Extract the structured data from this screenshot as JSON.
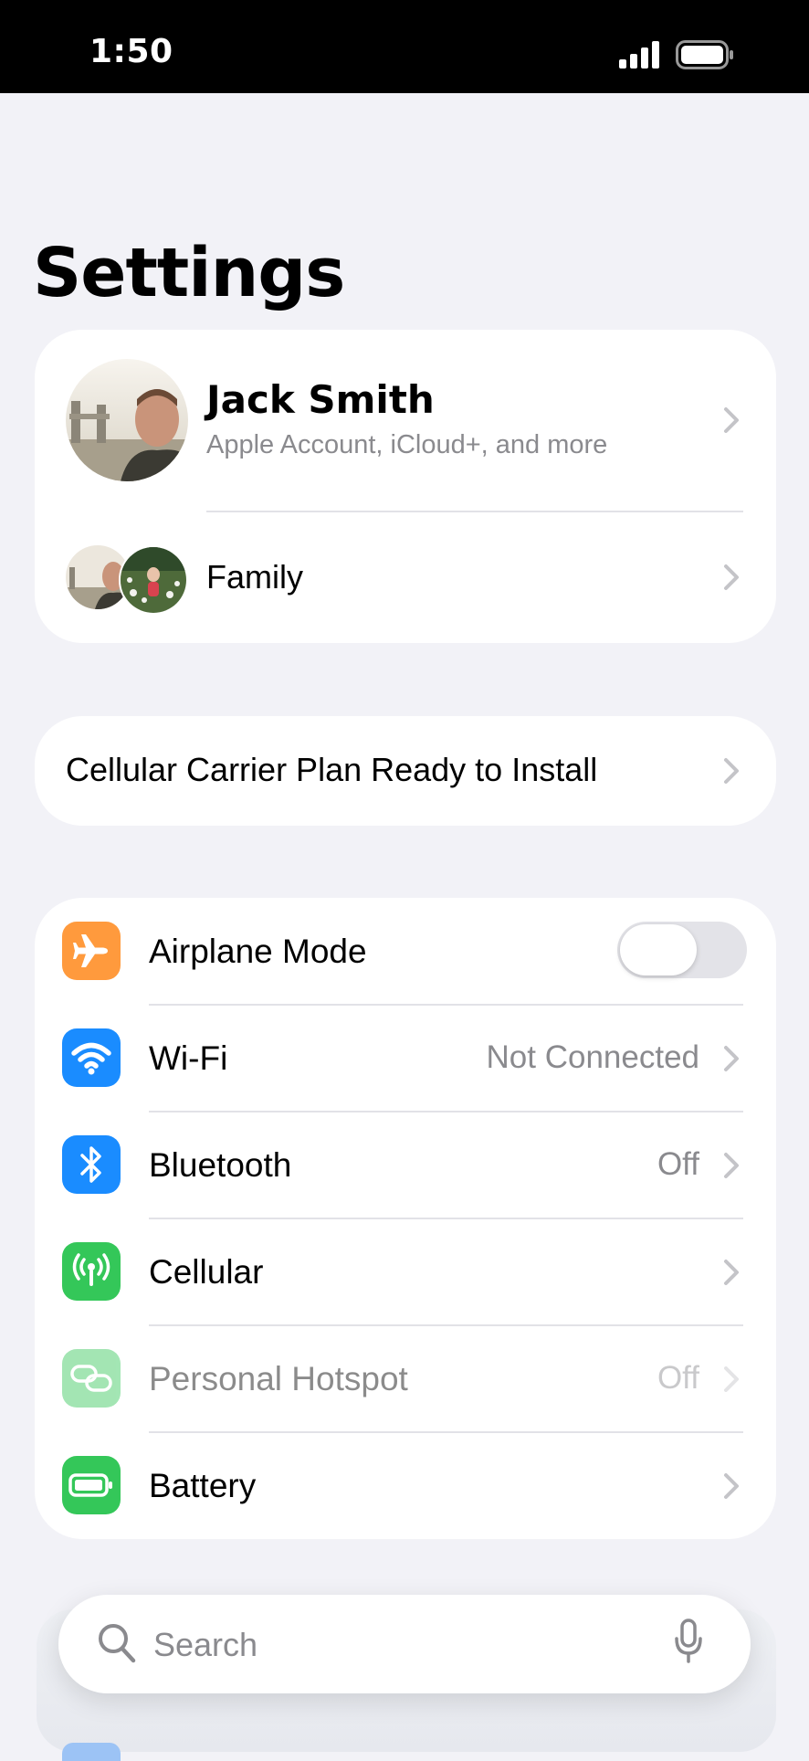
{
  "status_bar": {
    "time": "1:50"
  },
  "page": {
    "title": "Settings"
  },
  "account": {
    "name": "Jack Smith",
    "subtitle": "Apple Account, iCloud+, and more",
    "family_label": "Family"
  },
  "carrier_banner": {
    "label": "Cellular Carrier Plan Ready to Install"
  },
  "settings": [
    {
      "label": "Airplane Mode",
      "value": "",
      "icon": "airplane-icon",
      "color": "#ff9a3d",
      "control": "toggle",
      "toggle_on": false
    },
    {
      "label": "Wi-Fi",
      "value": "Not Connected",
      "icon": "wifi-icon",
      "color": "#1a8cff",
      "control": "chevron"
    },
    {
      "label": "Bluetooth",
      "value": "Off",
      "icon": "bluetooth-icon",
      "color": "#1a8cff",
      "control": "chevron"
    },
    {
      "label": "Cellular",
      "value": "",
      "icon": "cellular-antenna-icon",
      "color": "#34c759",
      "control": "chevron"
    },
    {
      "label": "Personal Hotspot",
      "value": "Off",
      "icon": "hotspot-link-icon",
      "color": "#34c759",
      "control": "chevron",
      "disabled": true
    },
    {
      "label": "Battery",
      "value": "",
      "icon": "battery-icon",
      "color": "#34c759",
      "control": "chevron"
    }
  ],
  "search": {
    "placeholder": "Search"
  }
}
